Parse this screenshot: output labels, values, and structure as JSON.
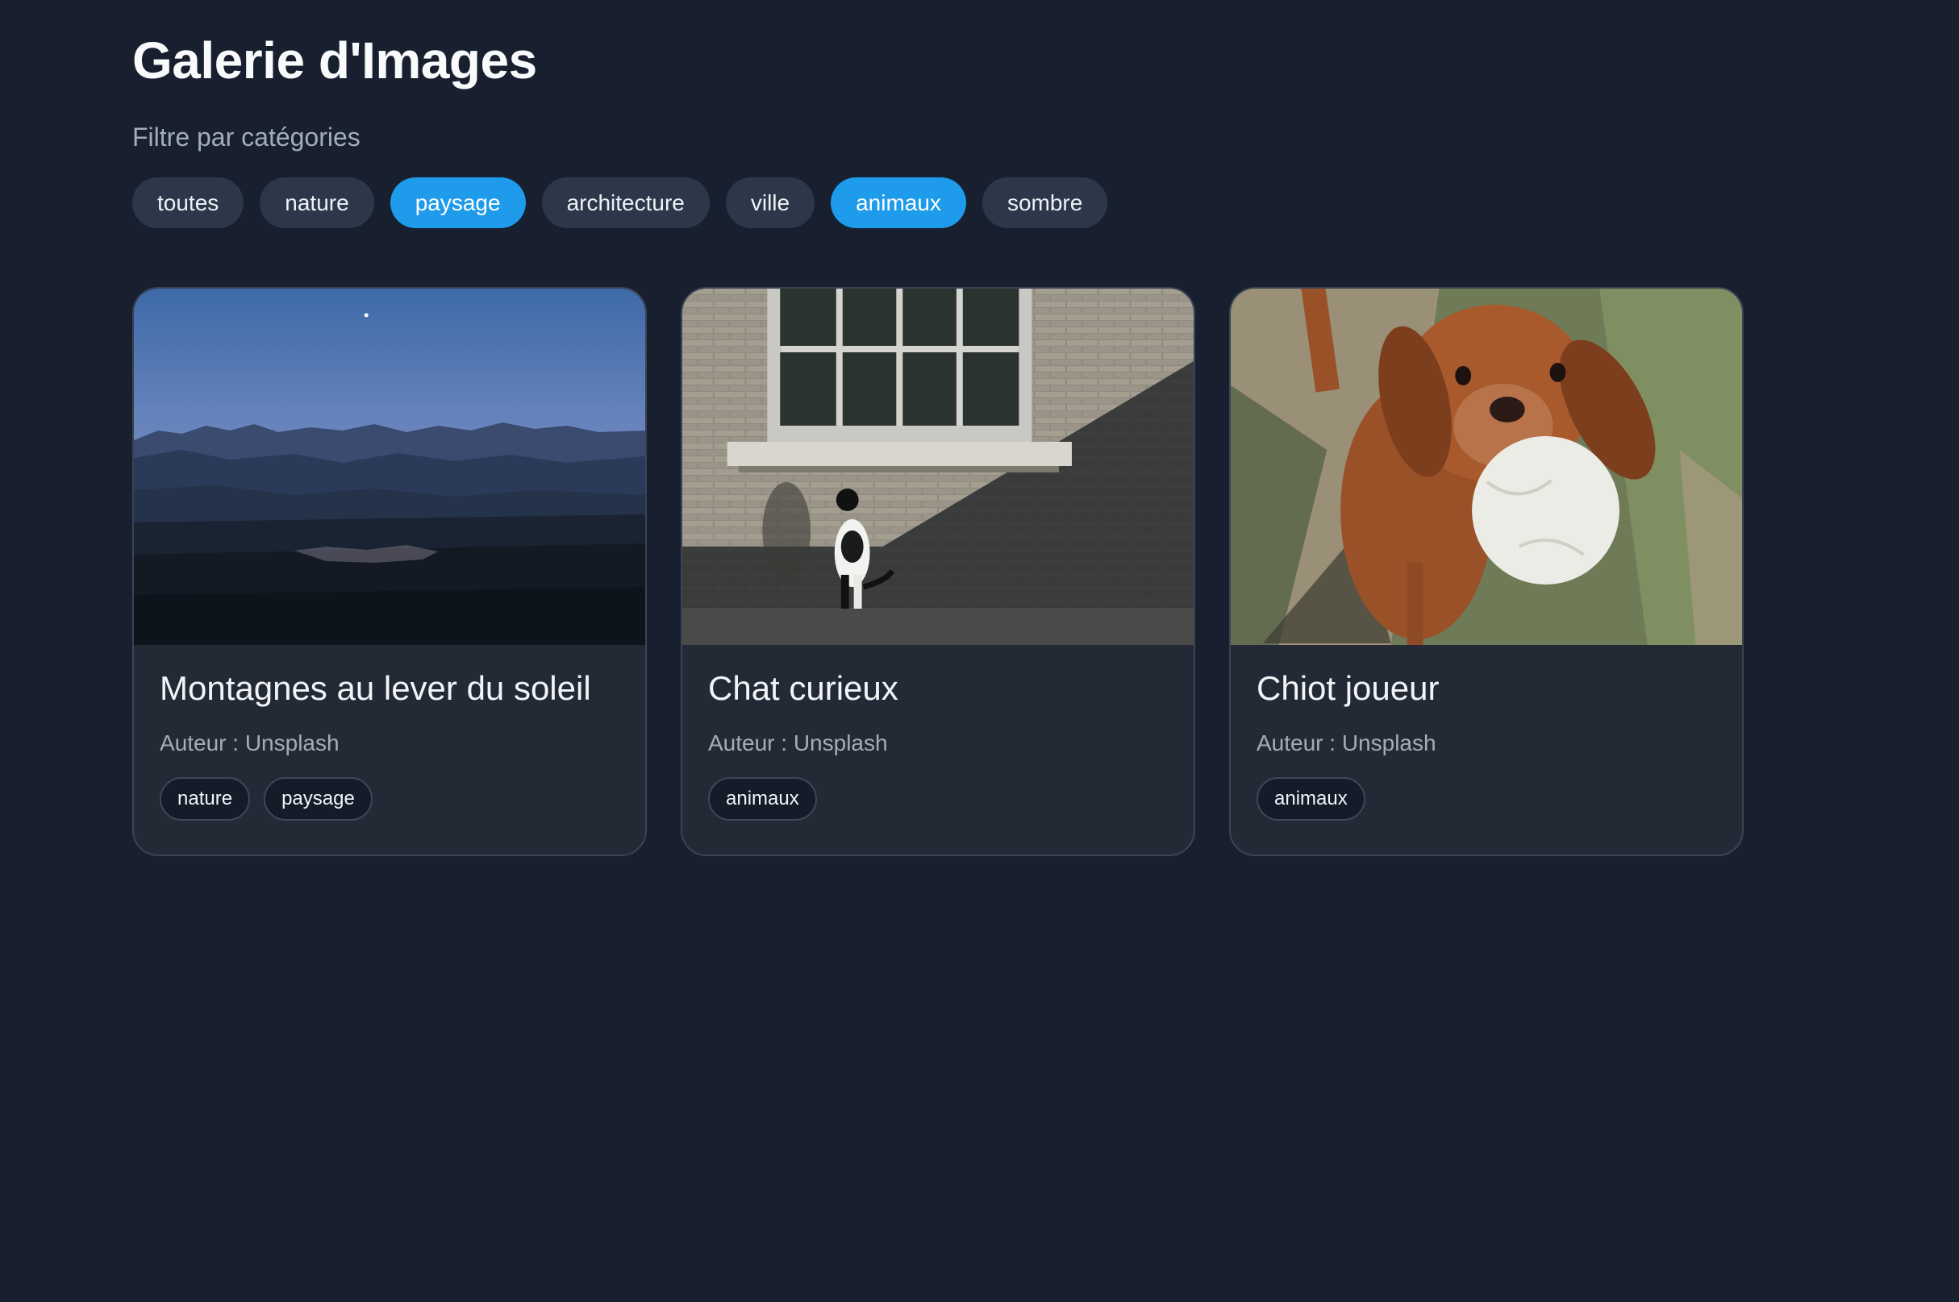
{
  "header": {
    "title": "Galerie d'Images",
    "filter_label": "Filtre par catégories"
  },
  "filters": [
    {
      "label": "toutes",
      "active": false
    },
    {
      "label": "nature",
      "active": false
    },
    {
      "label": "paysage",
      "active": true
    },
    {
      "label": "architecture",
      "active": false
    },
    {
      "label": "ville",
      "active": false
    },
    {
      "label": "animaux",
      "active": true
    },
    {
      "label": "sombre",
      "active": false
    }
  ],
  "cards": [
    {
      "title": "Montagnes au lever du soleil",
      "author": "Auteur : Unsplash",
      "image": "mountain-sunrise-photo",
      "tags": [
        "nature",
        "paysage"
      ]
    },
    {
      "title": "Chat curieux",
      "author": "Auteur : Unsplash",
      "image": "cat-at-window-photo",
      "tags": [
        "animaux"
      ]
    },
    {
      "title": "Chiot joueur",
      "author": "Auteur : Unsplash",
      "image": "puppy-with-ball-photo",
      "tags": [
        "animaux"
      ]
    }
  ],
  "colors": {
    "background": "#182030",
    "chip": "#2c3849",
    "chip_active": "#1e9bea",
    "card": "#242a35",
    "tag": "#141b29"
  }
}
